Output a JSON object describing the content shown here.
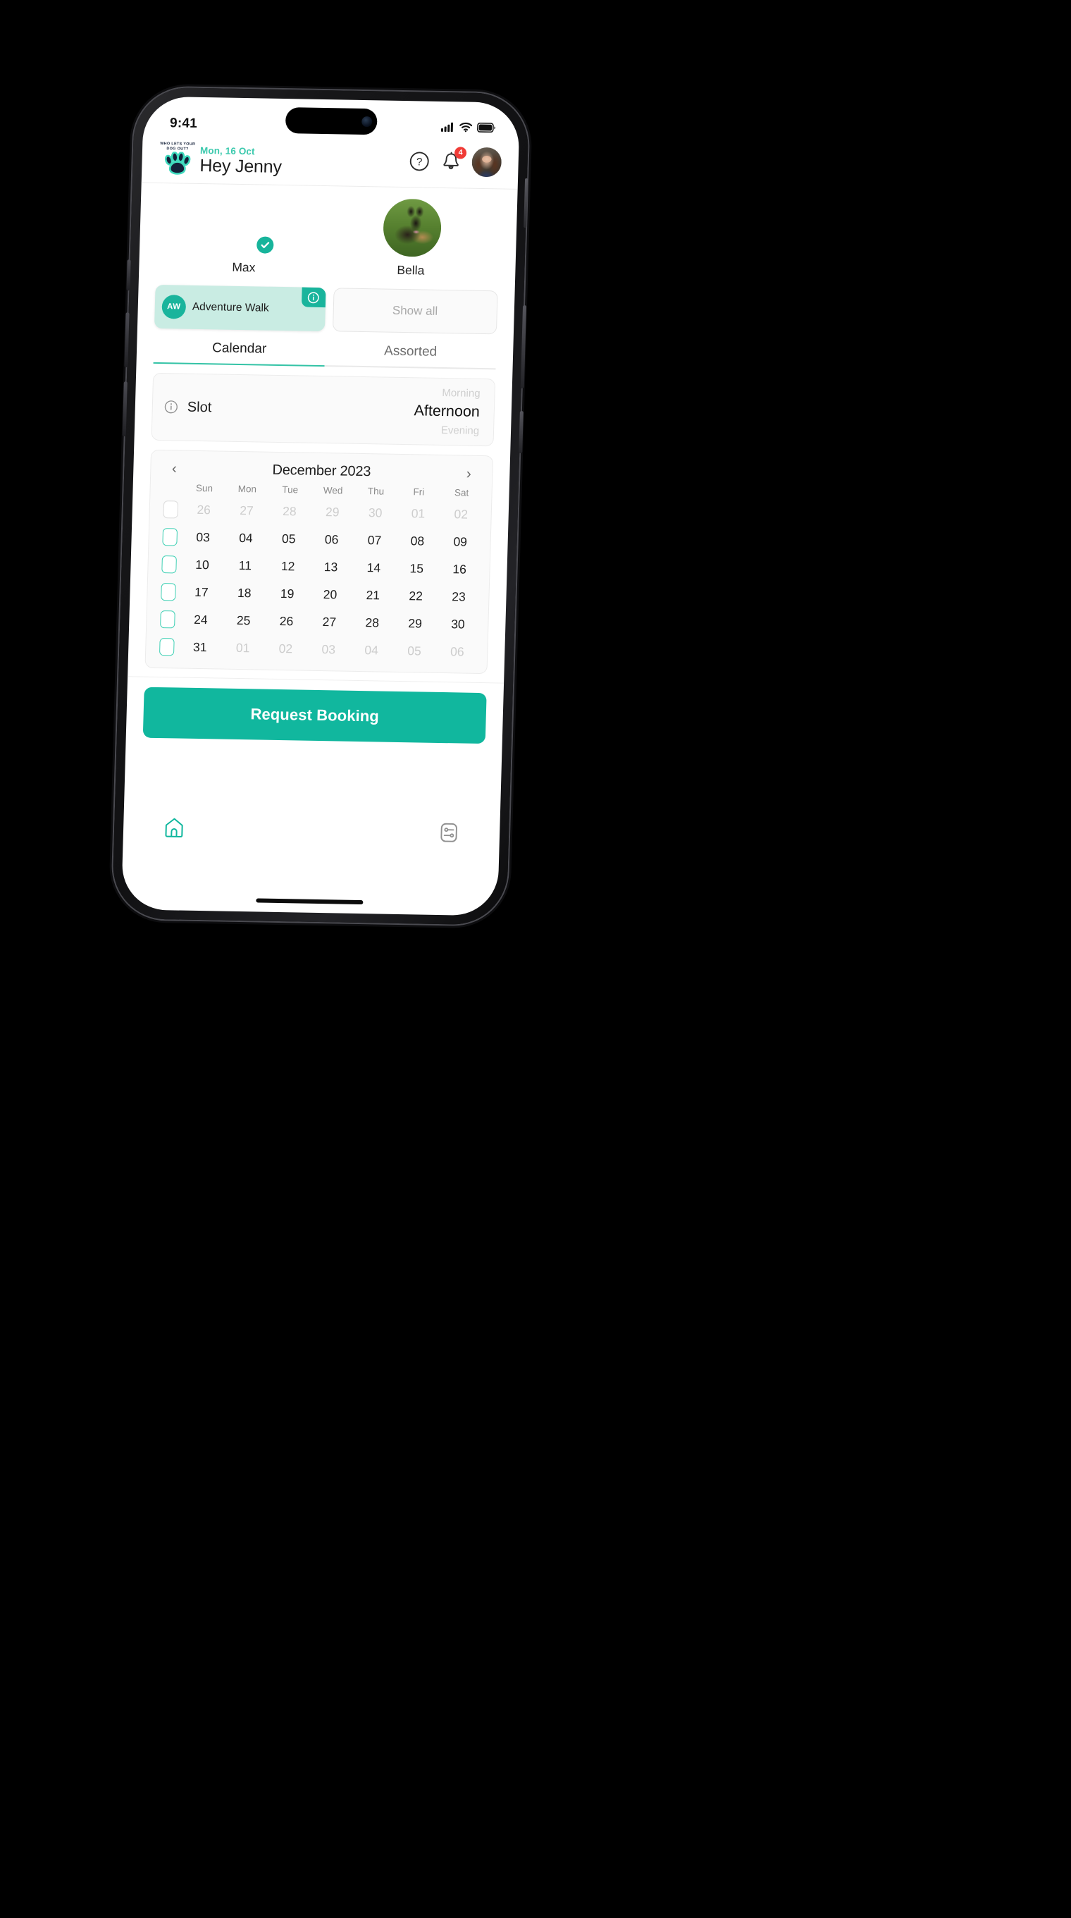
{
  "status_bar": {
    "time": "9:41",
    "icons": [
      "cellular-signal-icon",
      "wifi-icon",
      "battery-icon"
    ]
  },
  "header": {
    "logo_line1": "Who lets your",
    "logo_line2": "dog out?",
    "logo_icon": "paw-print-icon",
    "date": "Mon, 16 Oct",
    "greeting": "Hey Jenny",
    "help_icon": "help-circle-icon",
    "notifications_icon": "bell-icon",
    "notifications_count": "4",
    "avatar_name": "user-avatar"
  },
  "pets": [
    {
      "name": "Max",
      "selected": true,
      "badge_icon": "check-circle-icon"
    },
    {
      "name": "Bella",
      "selected": false,
      "badge_icon": ""
    }
  ],
  "services": {
    "selected": {
      "initials": "AW",
      "label": "Adventure Walk",
      "info_icon": "info-circle-icon"
    },
    "show_all_label": "Show all"
  },
  "tabs": [
    {
      "label": "Calendar",
      "active": true
    },
    {
      "label": "Assorted",
      "active": false
    }
  ],
  "slot": {
    "info_icon": "info-circle-icon",
    "label": "Slot",
    "options": [
      "Morning",
      "Afternoon",
      "Evening"
    ],
    "selected": "Afternoon"
  },
  "calendar": {
    "prev_icon": "chevron-left-icon",
    "next_icon": "chevron-right-icon",
    "title": "December 2023",
    "weekdays": [
      "Sun",
      "Mon",
      "Tue",
      "Wed",
      "Thu",
      "Fri",
      "Sat"
    ],
    "rows": [
      {
        "checkbox": "inactive",
        "days": [
          {
            "d": "26",
            "muted": true
          },
          {
            "d": "27",
            "muted": true
          },
          {
            "d": "28",
            "muted": true
          },
          {
            "d": "29",
            "muted": true
          },
          {
            "d": "30",
            "muted": true
          },
          {
            "d": "01",
            "muted": true
          },
          {
            "d": "02",
            "muted": true
          }
        ]
      },
      {
        "checkbox": "active",
        "days": [
          {
            "d": "03",
            "muted": false
          },
          {
            "d": "04",
            "muted": false
          },
          {
            "d": "05",
            "muted": false
          },
          {
            "d": "06",
            "muted": false
          },
          {
            "d": "07",
            "muted": false
          },
          {
            "d": "08",
            "muted": false
          },
          {
            "d": "09",
            "muted": false
          }
        ]
      },
      {
        "checkbox": "active",
        "days": [
          {
            "d": "10",
            "muted": false
          },
          {
            "d": "11",
            "muted": false
          },
          {
            "d": "12",
            "muted": false
          },
          {
            "d": "13",
            "muted": false
          },
          {
            "d": "14",
            "muted": false
          },
          {
            "d": "15",
            "muted": false
          },
          {
            "d": "16",
            "muted": false
          }
        ]
      },
      {
        "checkbox": "active",
        "days": [
          {
            "d": "17",
            "muted": false
          },
          {
            "d": "18",
            "muted": false
          },
          {
            "d": "19",
            "muted": false
          },
          {
            "d": "20",
            "muted": false
          },
          {
            "d": "21",
            "muted": false
          },
          {
            "d": "22",
            "muted": false
          },
          {
            "d": "23",
            "muted": false
          }
        ]
      },
      {
        "checkbox": "active",
        "days": [
          {
            "d": "24",
            "muted": false
          },
          {
            "d": "25",
            "muted": false
          },
          {
            "d": "26",
            "muted": false
          },
          {
            "d": "27",
            "muted": false
          },
          {
            "d": "28",
            "muted": false
          },
          {
            "d": "29",
            "muted": false
          },
          {
            "d": "30",
            "muted": false
          }
        ]
      },
      {
        "checkbox": "active",
        "days": [
          {
            "d": "31",
            "muted": false
          },
          {
            "d": "01",
            "muted": true
          },
          {
            "d": "02",
            "muted": true
          },
          {
            "d": "03",
            "muted": true
          },
          {
            "d": "04",
            "muted": true
          },
          {
            "d": "05",
            "muted": true
          },
          {
            "d": "06",
            "muted": true
          }
        ]
      }
    ]
  },
  "cta": {
    "label": "Request Booking"
  },
  "bottom_nav": [
    {
      "icon": "home-icon",
      "active": true
    },
    {
      "icon": "sliders-settings-icon",
      "active": false
    }
  ],
  "colors": {
    "accent": "#11b79e",
    "accent_light": "#c9ece3",
    "accent_text": "#3bc9ad",
    "badge_red": "#f03b36",
    "muted": "#cdcdcd"
  }
}
